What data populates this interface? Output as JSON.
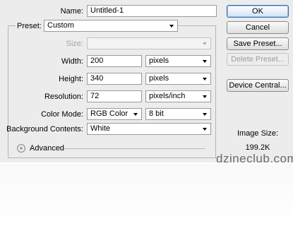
{
  "dialog": {
    "name_label": "Name:",
    "name_value": "Untitled-1",
    "preset_label": "Preset:",
    "preset_value": "Custom",
    "size_label": "Size:",
    "size_value": "",
    "width_label": "Width:",
    "width_value": "200",
    "width_unit": "pixels",
    "height_label": "Height:",
    "height_value": "340",
    "height_unit": "pixels",
    "resolution_label": "Resolution:",
    "resolution_value": "72",
    "resolution_unit": "pixels/inch",
    "color_mode_label": "Color Mode:",
    "color_mode_value": "RGB Color",
    "bit_depth_value": "8 bit",
    "background_label": "Background Contents:",
    "background_value": "White",
    "advanced_label": "Advanced"
  },
  "buttons": {
    "ok": "OK",
    "cancel": "Cancel",
    "save_preset": "Save Preset...",
    "delete_preset": "Delete Preset...",
    "device_central": "Device Central..."
  },
  "info": {
    "image_size_label": "Image Size:",
    "image_size_value": "199.2K"
  },
  "watermark": "dzineclub.com"
}
